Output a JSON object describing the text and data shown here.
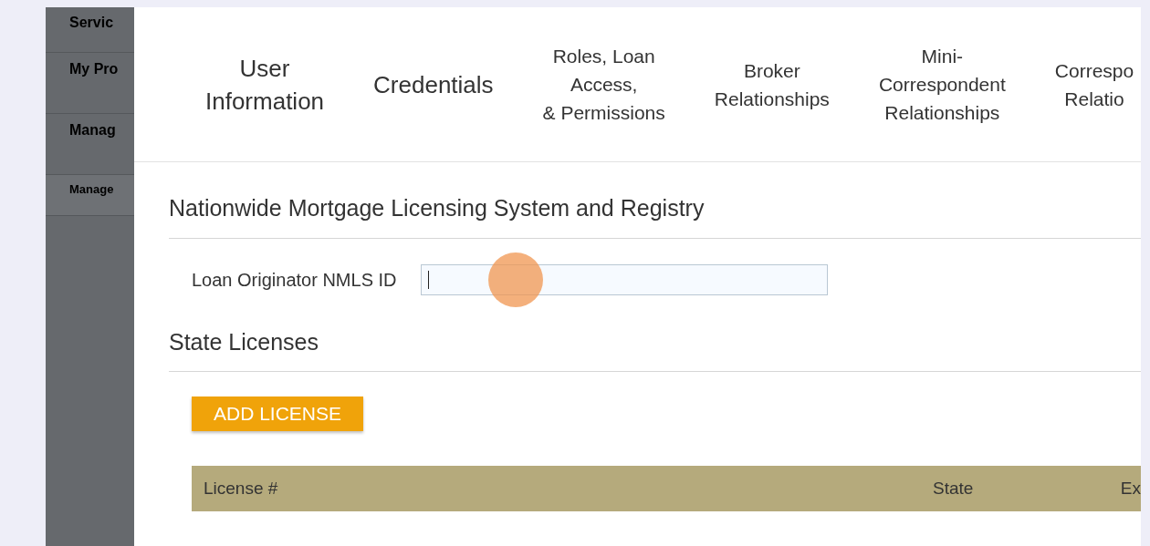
{
  "sidebar": {
    "items": [
      {
        "label": "Servic",
        "kind": "header"
      },
      {
        "label": "My Pro",
        "kind": "header"
      },
      {
        "label": "Manag",
        "kind": "header"
      },
      {
        "label": "Manage",
        "kind": "sub"
      }
    ]
  },
  "tabs": [
    {
      "lines": [
        "User",
        "Information"
      ],
      "kind": "large"
    },
    {
      "lines": [
        "Credentials"
      ],
      "kind": "large"
    },
    {
      "lines": [
        "Roles, Loan",
        "Access,",
        "& Permissions"
      ],
      "kind": "small"
    },
    {
      "lines": [
        "Broker",
        "Relationships"
      ],
      "kind": "small"
    },
    {
      "lines": [
        "Mini-",
        "Correspondent",
        "Relationships"
      ],
      "kind": "small"
    },
    {
      "lines": [
        "Correspo",
        "Relatio"
      ],
      "kind": "small"
    }
  ],
  "nmls": {
    "heading": "Nationwide Mortgage Licensing System and Registry",
    "field_label": "Loan Originator NMLS ID"
  },
  "licenses": {
    "heading": "State Licenses",
    "button": "ADD LICENSE",
    "table": {
      "columns": [
        "License #",
        "State",
        "Ex"
      ]
    }
  }
}
